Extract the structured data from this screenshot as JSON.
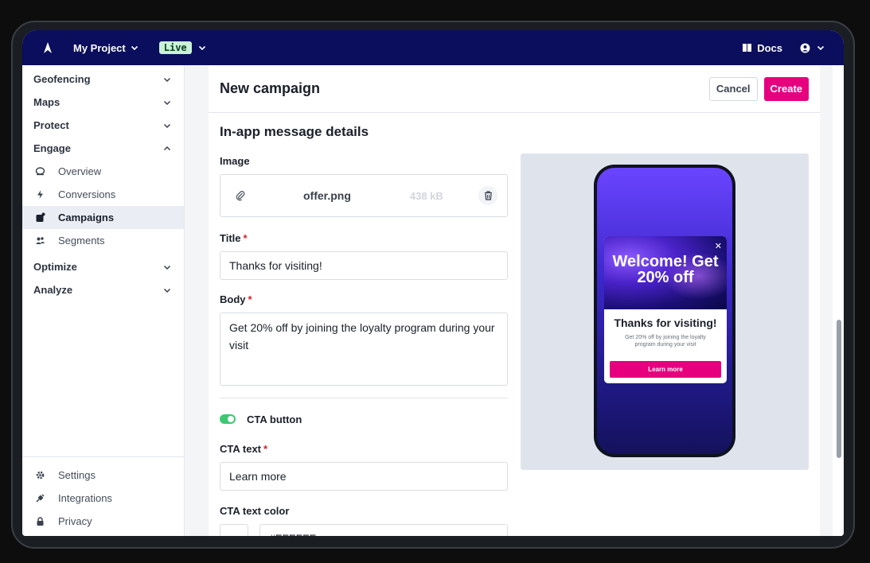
{
  "topbar": {
    "project": "My Project",
    "environment": "Live",
    "docs": "Docs"
  },
  "sidebar": {
    "groups": [
      {
        "label": "Geofencing"
      },
      {
        "label": "Maps"
      },
      {
        "label": "Protect"
      },
      {
        "label": "Engage"
      }
    ],
    "engage_items": [
      {
        "label": "Overview",
        "icon": "overview-icon"
      },
      {
        "label": "Conversions",
        "icon": "bolt-icon"
      },
      {
        "label": "Campaigns",
        "icon": "campaigns-icon",
        "active": true
      },
      {
        "label": "Segments",
        "icon": "users-icon"
      }
    ],
    "groups_after": [
      {
        "label": "Optimize"
      },
      {
        "label": "Analyze"
      }
    ],
    "bottom": [
      {
        "label": "Settings",
        "icon": "gear-icon"
      },
      {
        "label": "Integrations",
        "icon": "plug-icon"
      },
      {
        "label": "Privacy",
        "icon": "lock-icon"
      }
    ]
  },
  "main": {
    "title": "New campaign",
    "cancel": "Cancel",
    "create": "Create",
    "section": "In-app message details",
    "image_label": "Image",
    "image_file": "offer.png",
    "image_size": "438 kB",
    "title_label": "Title",
    "title_value": "Thanks for visiting!",
    "body_label": "Body",
    "body_value": "Get 20% off by joining the loyalty program during your visit",
    "cta_toggle_label": "CTA button",
    "cta_text_label": "CTA text",
    "cta_text_value": "Learn more",
    "cta_color_label": "CTA text color",
    "cta_color_value": "#FFFFFF"
  },
  "preview": {
    "headline": "Welcome! Get 20% off",
    "title": "Thanks for visiting!",
    "body": "Get 20% off by joining the loyalty program during your visit",
    "button": "Learn more"
  },
  "colors": {
    "accent": "#e6007e",
    "topbar": "#0a0e5c",
    "toggle_on": "#3cc873"
  }
}
